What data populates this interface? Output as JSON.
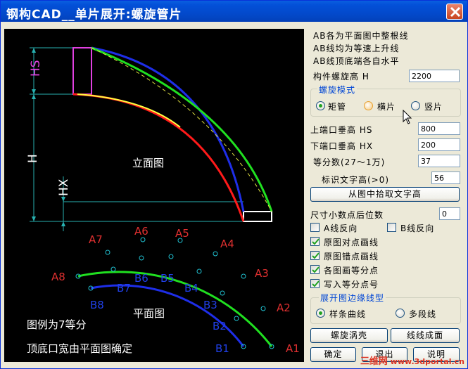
{
  "window": {
    "title": "钢构CAD__单片展开:螺旋管片"
  },
  "canvas": {
    "label_hs": "HS",
    "label_h": "H",
    "label_hx": "HX",
    "elevation_caption": "立面图",
    "plan_caption": "平面图",
    "note1": "图例为7等分",
    "note2": "顶底口宽由平面图确定",
    "outer_labels": [
      "A1",
      "A2",
      "A3",
      "A4",
      "A5",
      "A6",
      "A7",
      "A8"
    ],
    "inner_labels": [
      "B1",
      "B2",
      "B3",
      "B4",
      "B5",
      "B6",
      "B7",
      "B8"
    ]
  },
  "panel": {
    "info1": "AB各为平面图中整根线",
    "info2": "AB线均为等速上升线",
    "info3": "AB线顶底端各自水平",
    "height_label": "构件螺旋高 H",
    "height_value": "2200",
    "mode_group": "螺旋模式",
    "mode_options": [
      "矩管",
      "横片",
      "竖片"
    ],
    "mode_selected": "矩管",
    "hs_label": "上端口垂高 HS",
    "hs_value": "800",
    "hx_label": "下端口垂高 HX",
    "hx_value": "200",
    "div_label": "等分数(27～1万)",
    "div_value": "37",
    "text_h_label": "标识文字高(>0)",
    "text_h_value": "56",
    "pick_text_btn": "从图中拾取文字高",
    "decimal_label": "尺寸小数点后位数",
    "decimal_value": "0",
    "check_a_rev": "A线反向",
    "check_b_rev": "B线反向",
    "check_pair": "原图对点画线",
    "check_stagger": "原图错点画线",
    "check_equal": "各图画等分点",
    "check_write": "写入等分点号",
    "edge_group": "展开图边缘线型",
    "edge_options": [
      "样条曲线",
      "多段线"
    ],
    "edge_selected": "样条曲线",
    "spiral_btn": "螺旋涡壳",
    "surface_btn": "线线成面",
    "ok_btn": "确定",
    "exit_btn": "退出",
    "help_btn": "说明"
  },
  "watermark": {
    "cn": "三维网",
    "url": "www.3dportal.cn"
  }
}
